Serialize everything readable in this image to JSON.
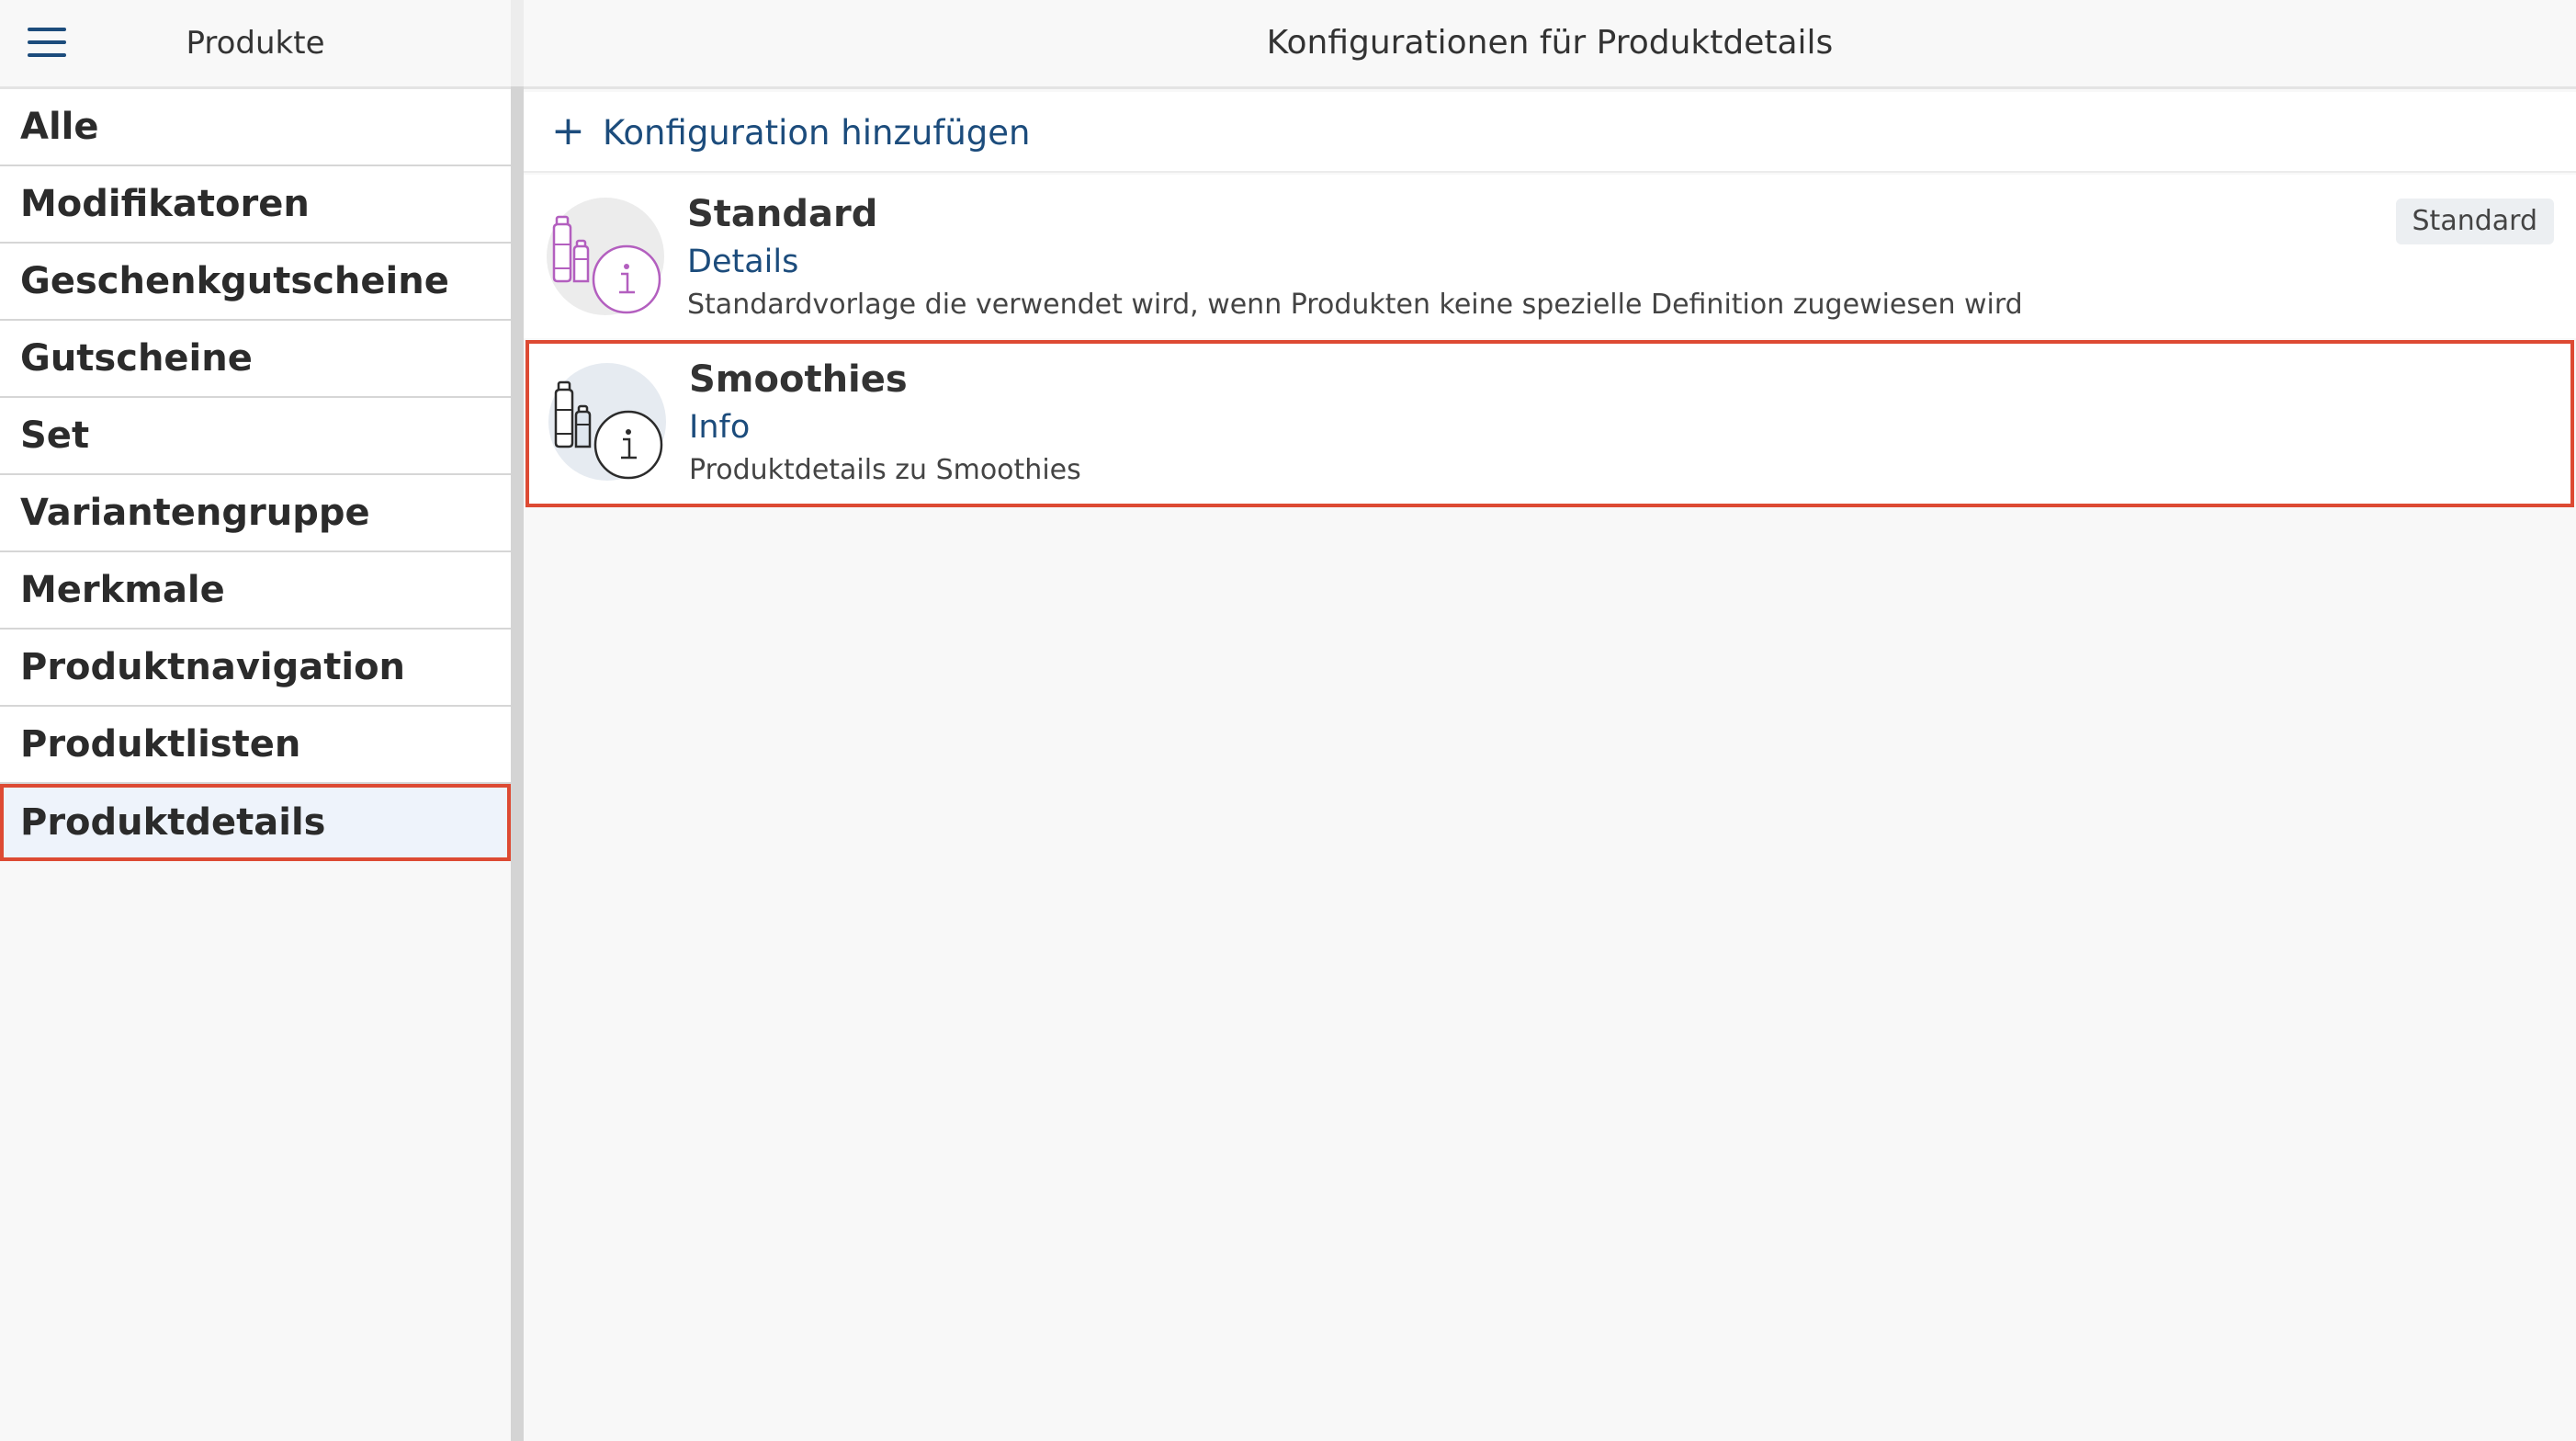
{
  "sidebar": {
    "title": "Produkte",
    "items": [
      {
        "label": "Alle"
      },
      {
        "label": "Modifikatoren"
      },
      {
        "label": "Geschenkgutscheine"
      },
      {
        "label": "Gutscheine"
      },
      {
        "label": "Set"
      },
      {
        "label": "Variantengruppe"
      },
      {
        "label": "Merkmale"
      },
      {
        "label": "Produktnavigation"
      },
      {
        "label": "Produktlisten"
      },
      {
        "label": "Produktdetails"
      }
    ],
    "active_item": "Produktdetails"
  },
  "main": {
    "title": "Konfigurationen für Produktdetails",
    "add_label": "Konfiguration hinzufügen",
    "configs": [
      {
        "title": "Standard",
        "subtitle": "Details",
        "description": "Standardvorlage die verwendet wird, wenn Produkten keine spezielle Definition zugewiesen wird",
        "badge": "Standard",
        "icon": "product-info-icon",
        "icon_color": "#b35fbf"
      },
      {
        "title": "Smoothies",
        "subtitle": "Info",
        "description": "Produktdetails zu Smoothies",
        "icon": "product-info-icon",
        "icon_color": "#2b2b2b"
      }
    ]
  },
  "colors": {
    "accent": "#1c4c7c",
    "highlight": "#dd4a33",
    "active_bg": "#eef3fb"
  }
}
